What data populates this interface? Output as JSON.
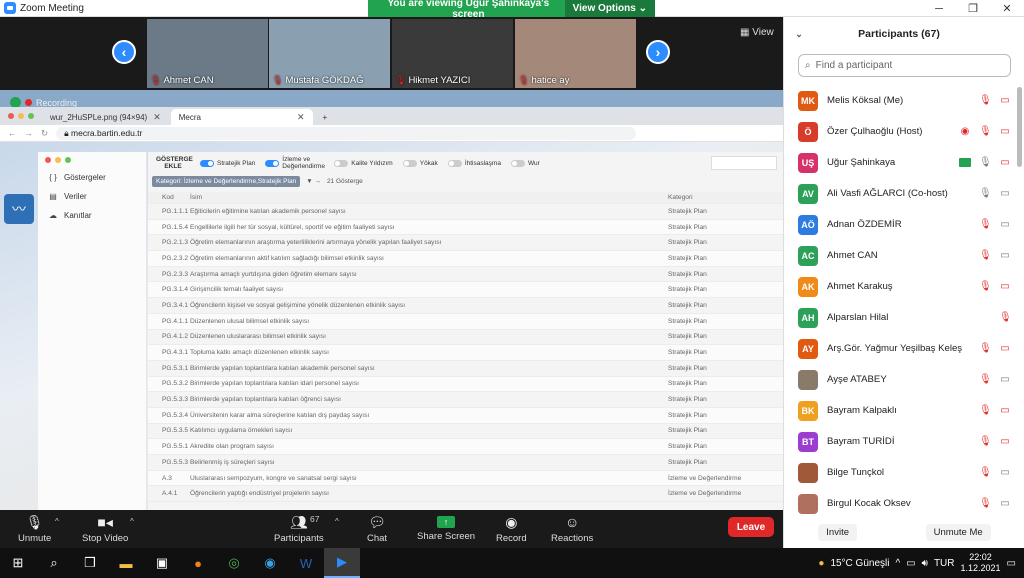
{
  "window": {
    "title": "Zoom Meeting"
  },
  "share_banner": {
    "text": "You are viewing Uğur Şahinkaya's screen",
    "view_options": "View Options"
  },
  "strip": {
    "view_label": "View",
    "tiles": [
      {
        "name": "Ahmet CAN",
        "bg": "#6b7a86"
      },
      {
        "name": "Mustafa GÖKDAĞ",
        "bg": "#8aa0b0"
      },
      {
        "name": "Hikmet YAZICI",
        "bg": "#3a3a3a"
      },
      {
        "name": "hatice ay",
        "bg": "#a4897a"
      }
    ]
  },
  "shared": {
    "recording": "Recording",
    "tabs": [
      {
        "label": "wur_2HuSPLe.png (94×94)"
      },
      {
        "label": "Mecra"
      }
    ],
    "url": "mecra.bartin.edu.tr",
    "sidebar": [
      {
        "label": "Göstergeler",
        "icon": "brackets-icon"
      },
      {
        "label": "Veriler",
        "icon": "table-icon"
      },
      {
        "label": "Kanıtlar",
        "icon": "cloud-icon"
      }
    ],
    "toolbar": {
      "add": "GÖSTERGE EKLE",
      "toggles": [
        {
          "label": "Stratejik Plan",
          "on": true
        },
        {
          "label": "İzleme ve Değerlendirme",
          "on": true
        },
        {
          "label": "Kalite Yıldızım",
          "on": false
        },
        {
          "label": "Yökak",
          "on": false
        },
        {
          "label": "İhtisaslaşma",
          "on": false
        },
        {
          "label": "Wur",
          "on": false
        }
      ]
    },
    "filter": {
      "chip": "Kategori: İzleme ve Değerlendirme,Stratejik Plan",
      "count": "21 Gösterge"
    },
    "table": {
      "headers": [
        "Kod",
        "İsim",
        "Kategori"
      ],
      "rows": [
        [
          "PG.1.1.1",
          "Eğiticilerin eğitimine katılan akademik personel sayısı",
          "Stratejik Plan"
        ],
        [
          "PG.1.5.4",
          "Engellilerle ilgili her tür sosyal, kültürel, sportif ve eğitim faaliyeti sayısı",
          "Stratejik Plan"
        ],
        [
          "PG.2.1.3",
          "Öğretim elemanlarının araştırma yeterliliklerini artırmaya yönelik yapılan faaliyet sayısı",
          "Stratejik Plan"
        ],
        [
          "PG.2.3.2",
          "Öğretim elemanlarının aktif katılım sağladığı bilimsel etkinlik sayısı",
          "Stratejik Plan"
        ],
        [
          "PG.2.3.3",
          "Araştırma amaçlı yurtdışına giden öğretim elemanı sayısı",
          "Stratejik Plan"
        ],
        [
          "PG.3.1.4",
          "Girişimcilik temalı faaliyet sayısı",
          "Stratejik Plan"
        ],
        [
          "PG.3.4.1",
          "Öğrencilerin kişisel ve sosyal gelişimine yönelik düzenlenen etkinlik sayısı",
          "Stratejik Plan"
        ],
        [
          "PG.4.1.1",
          "Düzenlenen ulusal bilimsel etkinlik sayısı",
          "Stratejik Plan"
        ],
        [
          "PG.4.1.2",
          "Düzenlenen uluslararası bilimsel etkinlik sayısı",
          "Stratejik Plan"
        ],
        [
          "PG.4.3.1",
          "Topluma katkı amaçlı düzenlenen etkinlik sayısı",
          "Stratejik Plan"
        ],
        [
          "PG.5.3.1",
          "Birimlerde yapılan toplantılara katılan akademik personel sayısı",
          "Stratejik Plan"
        ],
        [
          "PG.5.3.2",
          "Birimlerde yapılan toplantılara katılan idari personel sayısı",
          "Stratejik Plan"
        ],
        [
          "PG.5.3.3",
          "Birimlerde yapılan toplantılara katılan öğrenci sayısı",
          "Stratejik Plan"
        ],
        [
          "PG.5.3.4",
          "Üniversitenin karar alma süreçlerine katılan dış paydaş sayısı",
          "Stratejik Plan"
        ],
        [
          "PG.5.3.5",
          "Katılımcı uygulama örnekleri sayısı",
          "Stratejik Plan"
        ],
        [
          "PG.5.5.1",
          "Akredite olan program sayısı",
          "Stratejik Plan"
        ],
        [
          "PG.5.5.3",
          "Belirlenmiş iş süreçleri sayısı",
          "Stratejik Plan"
        ],
        [
          "A.3",
          "Uluslararası sempozyum, kongre ve sanatsal sergi sayısı",
          "İzleme ve Değerlendirme"
        ],
        [
          "A.4.1",
          "Öğrencilerin yaptığı endüstriyel projelerin sayısı",
          "İzleme ve Değerlendirme"
        ]
      ]
    }
  },
  "participants": {
    "title": "Participants (67)",
    "search_placeholder": "Find a participant",
    "list": [
      {
        "initials": "MK",
        "name": "Melis Köksal (Me)",
        "color": "#e05a12"
      },
      {
        "initials": "Ö",
        "name": "Özer Çulhaoğlu (Host)",
        "color": "#d93b2a"
      },
      {
        "initials": "UŞ",
        "name": "Uğur Şahinkaya",
        "color": "#d6326a"
      },
      {
        "initials": "AV",
        "name": "Ali Vasfi AĞLARCI (Co-host)",
        "color": "#2da05a"
      },
      {
        "initials": "AÖ",
        "name": "Adnan ÖZDEMİR",
        "color": "#2d7de0"
      },
      {
        "initials": "AC",
        "name": "Ahmet CAN",
        "color": "#2da05a"
      },
      {
        "initials": "AK",
        "name": "Ahmet Karakuş",
        "color": "#f08a1a"
      },
      {
        "initials": "AH",
        "name": "Alparslan Hilal",
        "color": "#2da05a"
      },
      {
        "initials": "AY",
        "name": "Arş.Gör. Yağmur Yeşilbaş Keleş",
        "color": "#e05a12"
      },
      {
        "initials": "",
        "name": "Ayşe ATABEY",
        "color": "#8a7a6a"
      },
      {
        "initials": "BK",
        "name": "Bayram Kalpaklı",
        "color": "#f0a020"
      },
      {
        "initials": "BT",
        "name": "Bayram TURİDİ",
        "color": "#9b3ed0"
      },
      {
        "initials": "",
        "name": "Bilge Tunçkol",
        "color": "#a05a3a"
      },
      {
        "initials": "",
        "name": "Birgul Kocak Oksev",
        "color": "#b07060"
      }
    ],
    "invite": "Invite",
    "unmute_me": "Unmute Me"
  },
  "zoombar": {
    "unmute": "Unmute",
    "stop_video": "Stop Video",
    "participants": "Participants",
    "participants_count": "67",
    "chat": "Chat",
    "share_screen": "Share Screen",
    "record": "Record",
    "reactions": "Reactions",
    "leave": "Leave"
  },
  "taskbar": {
    "weather": "15°C Güneşli",
    "time": "22:02",
    "date": "1.12.2021"
  }
}
